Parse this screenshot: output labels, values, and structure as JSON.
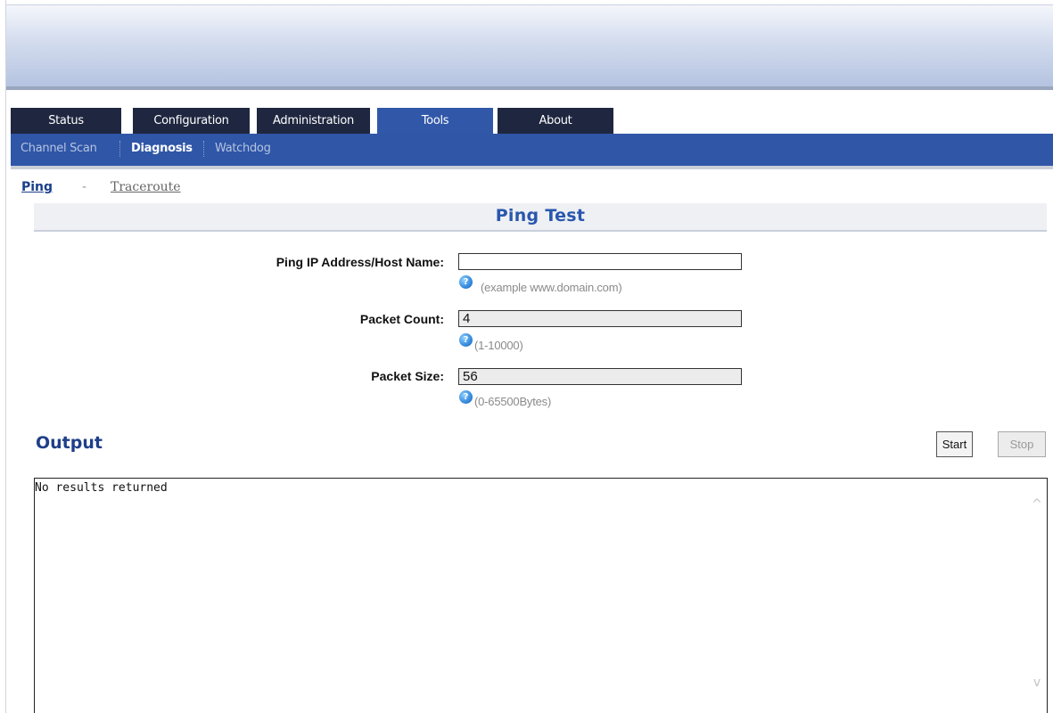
{
  "tabs": [
    {
      "label": "Status",
      "active": false
    },
    {
      "label": "Configuration",
      "active": false
    },
    {
      "label": "Administration",
      "active": false
    },
    {
      "label": "Tools",
      "active": true
    },
    {
      "label": "About",
      "active": false
    }
  ],
  "subnav": [
    {
      "label": "Channel Scan",
      "active": false
    },
    {
      "label": "Diagnosis",
      "active": true
    },
    {
      "label": "Watchdog",
      "active": false
    }
  ],
  "sublinks": {
    "ping": "Ping",
    "separator": "-",
    "traceroute": "Traceroute"
  },
  "section": {
    "title": "Ping Test"
  },
  "form": {
    "host": {
      "label": "Ping IP Address/Host Name:",
      "value": "",
      "hint": "(example www.domain.com)"
    },
    "count": {
      "label": "Packet Count:",
      "value": "4",
      "hint": "(1-10000)"
    },
    "size": {
      "label": "Packet Size:",
      "value": "56",
      "hint": "(0-65500Bytes)"
    }
  },
  "help_icon_glyph": "?",
  "output": {
    "title": "Output",
    "start_label": "Start",
    "stop_label": "Stop",
    "text": "No results returned",
    "scroll_up_glyph": "^",
    "scroll_down_glyph": "v"
  },
  "colors": {
    "nav_dark": "#1f2740",
    "nav_active": "#3158a8",
    "subnav_bg": "#2f56a7",
    "title_blue": "#2a57ad"
  }
}
